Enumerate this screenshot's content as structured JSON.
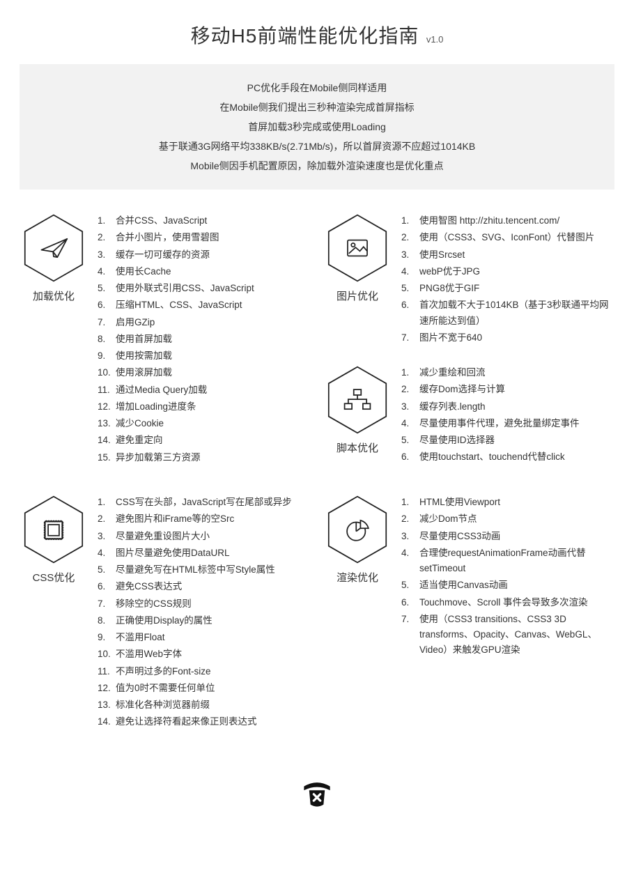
{
  "title": "移动H5前端性能优化指南",
  "version": "v1.0",
  "intro": [
    "PC优化手段在Mobile侧同样适用",
    "在Mobile侧我们提出三秒种渲染完成首屏指标",
    "首屏加载3秒完成或使用Loading",
    "基于联通3G网络平均338KB/s(2.71Mb/s)，所以首屏资源不应超过1014KB",
    "Mobile侧因手机配置原因，除加载外渲染速度也是优化重点"
  ],
  "sections": {
    "load": {
      "label": "加载优化",
      "items": [
        "合并CSS、JavaScript",
        "合并小图片，使用雪碧图",
        "缓存一切可缓存的资源",
        "使用长Cache",
        "使用外联式引用CSS、JavaScript",
        "压缩HTML、CSS、JavaScript",
        "启用GZip",
        "使用首屏加载",
        "使用按需加载",
        "使用滚屏加载",
        "通过Media Query加载",
        "增加Loading进度条",
        "减少Cookie",
        "避免重定向",
        "异步加载第三方资源"
      ]
    },
    "image": {
      "label": "图片优化",
      "items": [
        "使用智图 http://zhitu.tencent.com/",
        "使用（CSS3、SVG、IconFont）代替图片",
        "使用Srcset",
        "webP优于JPG",
        "PNG8优于GIF",
        "首次加载不大于1014KB（基于3秒联通平均网速所能达到值）",
        "图片不宽于640"
      ]
    },
    "script": {
      "label": "脚本优化",
      "items": [
        "减少重绘和回流",
        "缓存Dom选择与计算",
        "缓存列表.length",
        "尽量使用事件代理，避免批量绑定事件",
        "尽量使用ID选择器",
        "使用touchstart、touchend代替click"
      ]
    },
    "css": {
      "label": "CSS优化",
      "items": [
        "CSS写在头部，JavaScript写在尾部或异步",
        "避免图片和iFrame等的空Src",
        "尽量避免重设图片大小",
        "图片尽量避免使用DataURL",
        "尽量避免写在HTML标签中写Style属性",
        "避免CSS表达式",
        "移除空的CSS规则",
        "正确使用Display的属性",
        "不滥用Float",
        "不滥用Web字体",
        "不声明过多的Font-size",
        "值为0时不需要任何单位",
        "标准化各种浏览器前缀",
        "避免让选择符看起来像正则表达式"
      ]
    },
    "render": {
      "label": "渲染优化",
      "items": [
        "HTML使用Viewport",
        "减少Dom节点",
        "尽量使用CSS3动画",
        "合理使requestAnimationFrame动画代替setTimeout",
        "适当使用Canvas动画",
        "Touchmove、Scroll 事件会导致多次渲染",
        "使用（CSS3 transitions、CSS3 3D transforms、Opacity、Canvas、WebGL、Video）来触发GPU渲染"
      ]
    }
  }
}
